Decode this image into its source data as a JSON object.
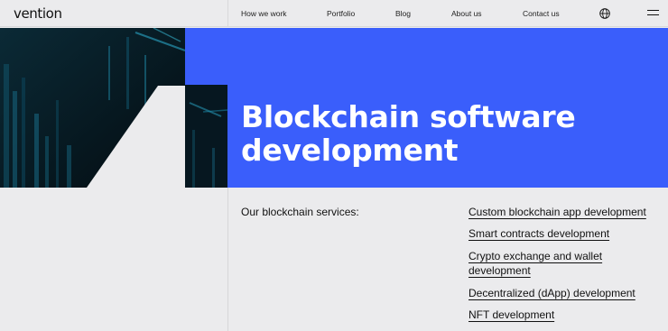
{
  "header": {
    "logo": "vention",
    "nav": [
      "How we work",
      "Portfolio",
      "Blog",
      "About us",
      "Contact us"
    ],
    "globe_icon": "globe-icon",
    "menu_icon": "hamburger-menu-icon"
  },
  "hero": {
    "title_line1": "Blockchain software",
    "title_line2": "development",
    "accent_color": "#3a5efb"
  },
  "services": {
    "label": "Our blockchain services:",
    "items": [
      "Custom blockchain app development",
      "Smart contracts development",
      "Crypto exchange and wallet development",
      "Decentralized (dApp) development",
      "NFT development"
    ]
  }
}
